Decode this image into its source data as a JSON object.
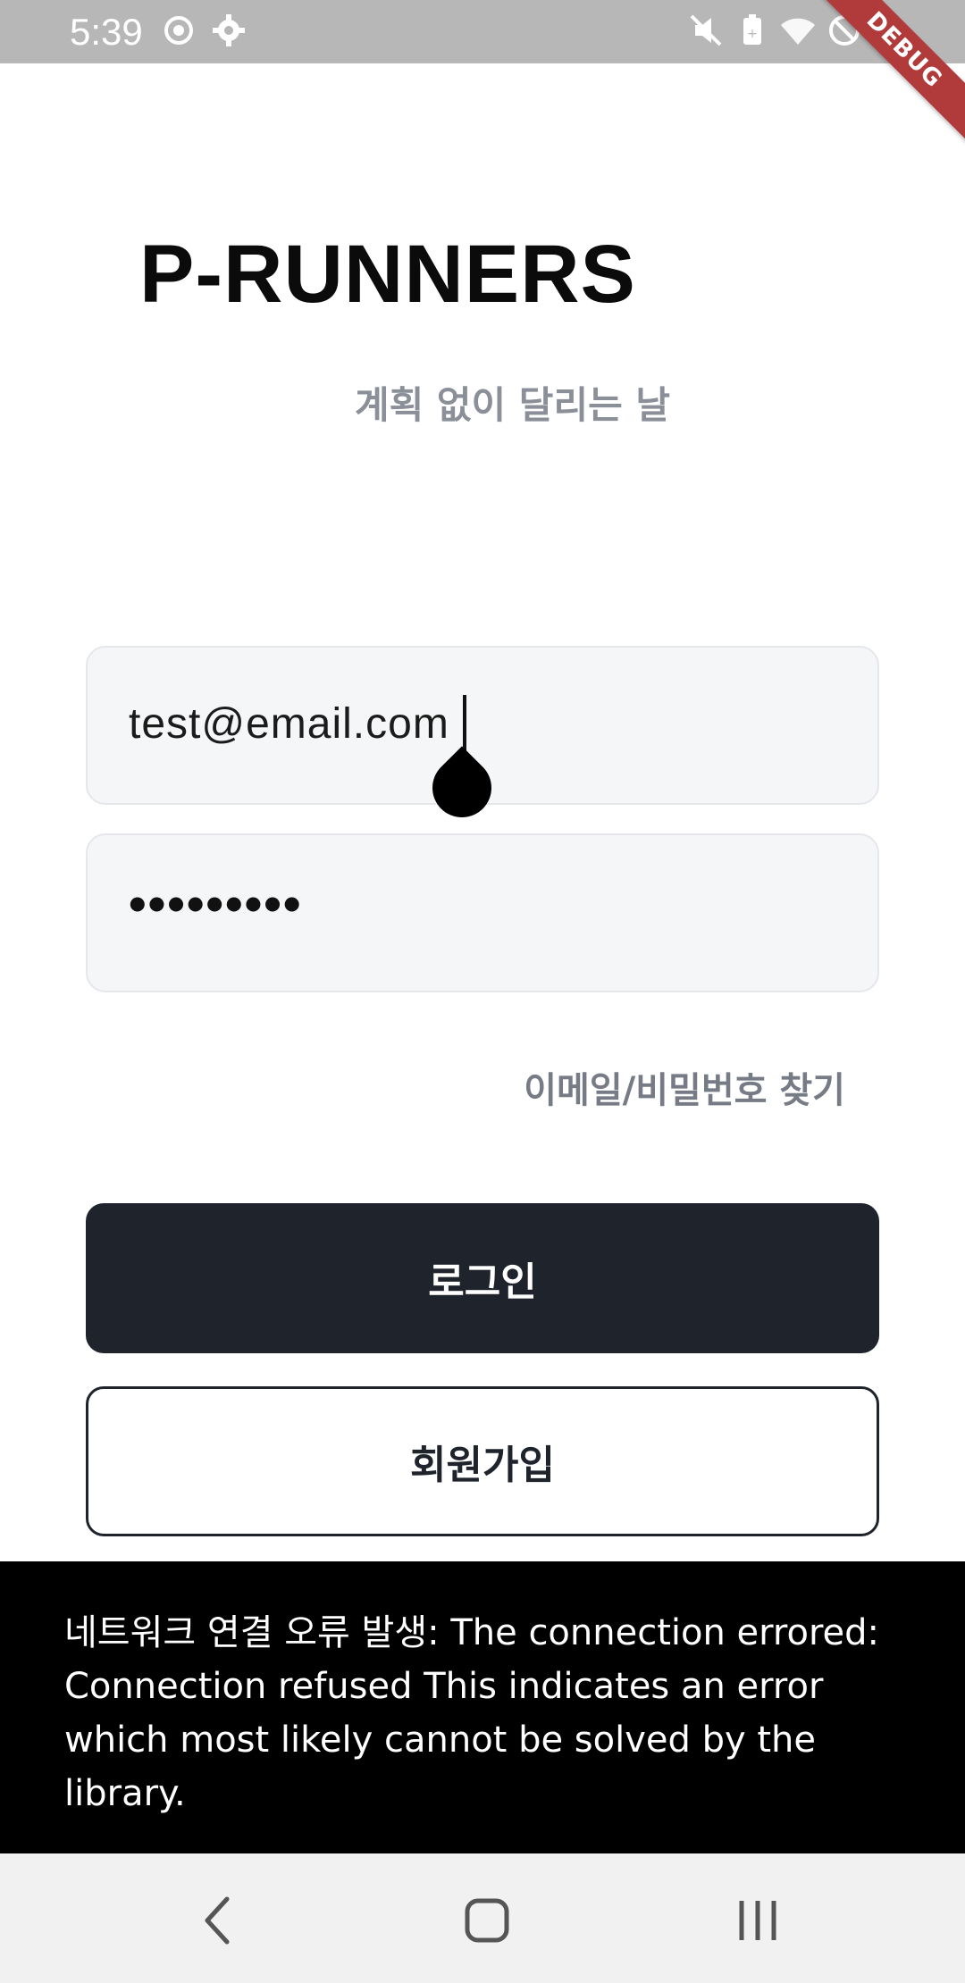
{
  "status_bar": {
    "time": "5:39",
    "left_icons": [
      "sync-icon",
      "gear-icon"
    ],
    "right_icons": [
      "mute-icon",
      "battery-saver-icon",
      "wifi-icon",
      "do-not-disturb-icon",
      "battery-icon"
    ]
  },
  "debug_banner": {
    "label": "DEBUG"
  },
  "header": {
    "title": "P-RUNNERS",
    "subtitle": "계획 없이 달리는 날"
  },
  "form": {
    "email": {
      "value": "test@email.com"
    },
    "password": {
      "masked_value": "•••••••••"
    },
    "find_link": "이메일/비밀번호 찾기",
    "login_button": "로그인",
    "signup_button": "회원가입"
  },
  "snackbar": {
    "message": "네트워크 연결 오류 발생: The connection errored: Connection refused This indicates an error which most likely cannot be solved by the library."
  },
  "nav_bar": {
    "buttons": [
      "back-icon",
      "home-icon",
      "recent-apps-icon"
    ]
  },
  "colors": {
    "status_bar": "#b7b7b7",
    "primary_button": "#1f232c",
    "input_bg": "#f5f6f8",
    "muted_text": "#8a8f98",
    "snackbar_bg": "#000000",
    "debug_banner": "#b13b3b"
  }
}
